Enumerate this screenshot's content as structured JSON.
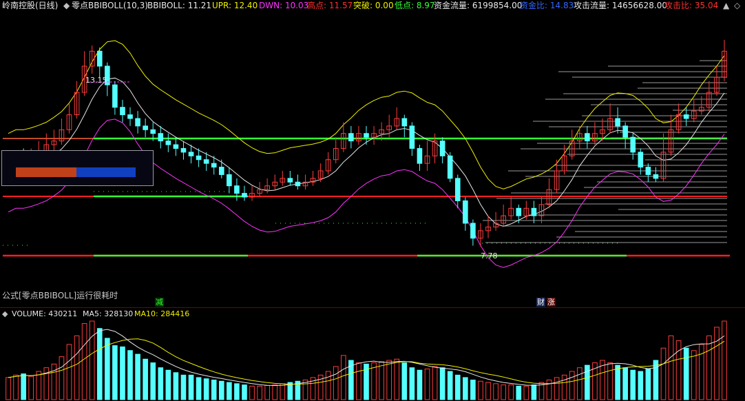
{
  "header": {
    "stock": "岭南控股(日线)",
    "indicator": "零点BBIBOLL(10,3)",
    "bbiboll": "BBIBOLL: 11.21",
    "upr": "UPR: 12.40",
    "dwn": "DWN: 10.03",
    "high": "高点: 11.57",
    "breakout": "突破: 0.00",
    "low": "低点: 8.97",
    "capital_flow": "资金流量: 6199854.00",
    "capital_ratio": "资金比: 14.83",
    "attack_flow": "攻击流量: 14656628.00",
    "attack_ratio": "攻击比: 35.04"
  },
  "colors": {
    "white": "#e8e8e8",
    "yellow": "#f0f000",
    "magenta": "#ff33ff",
    "red": "#ff3030",
    "green": "#33ff33",
    "blue": "#3366ff",
    "cyan": "#54ffff",
    "gray": "#c0c0c0"
  },
  "chart": {
    "high_label": "13.15",
    "low_label": "7.78"
  },
  "message": "公式[零点BBIBOLL]运行很耗时",
  "markers": {
    "reduce": "减",
    "finance": "财",
    "rise": "涨"
  },
  "volume": {
    "title": "VOLUME: 430211",
    "ma5": "MA5: 328130",
    "ma10": "MA10: 284416"
  },
  "chart_data": {
    "type": "candlestick",
    "price_range": [
      7.0,
      14.0
    ],
    "candles": [
      [
        9.8,
        9.8,
        10.2,
        9.5
      ],
      [
        9.8,
        10.0,
        10.3,
        9.6
      ],
      [
        10.0,
        9.9,
        10.4,
        9.7
      ],
      [
        9.9,
        10.1,
        10.4,
        9.7
      ],
      [
        10.1,
        10.3,
        10.6,
        10.0
      ],
      [
        10.3,
        10.5,
        10.8,
        10.1
      ],
      [
        10.5,
        10.6,
        10.9,
        10.3
      ],
      [
        10.6,
        10.9,
        11.2,
        10.5
      ],
      [
        10.9,
        11.3,
        11.6,
        10.8
      ],
      [
        11.3,
        11.9,
        12.2,
        11.2
      ],
      [
        11.9,
        12.6,
        13.0,
        11.8
      ],
      [
        12.6,
        13.0,
        13.15,
        12.4
      ],
      [
        13.0,
        12.6,
        13.1,
        12.3
      ],
      [
        12.6,
        12.1,
        12.7,
        11.8
      ],
      [
        12.1,
        11.5,
        12.2,
        11.3
      ],
      [
        11.5,
        11.3,
        11.7,
        11.1
      ],
      [
        11.3,
        11.2,
        11.5,
        11.0
      ],
      [
        11.2,
        11.0,
        11.4,
        10.8
      ],
      [
        11.0,
        10.9,
        11.2,
        10.7
      ],
      [
        10.9,
        10.8,
        11.1,
        10.6
      ],
      [
        10.8,
        10.6,
        11.0,
        10.4
      ],
      [
        10.6,
        10.5,
        10.8,
        10.3
      ],
      [
        10.5,
        10.4,
        10.7,
        10.2
      ],
      [
        10.4,
        10.3,
        10.6,
        10.1
      ],
      [
        10.3,
        10.2,
        10.5,
        10.0
      ],
      [
        10.2,
        10.1,
        10.4,
        9.9
      ],
      [
        10.1,
        10.0,
        10.3,
        9.8
      ],
      [
        10.0,
        9.9,
        10.2,
        9.7
      ],
      [
        9.9,
        9.7,
        10.1,
        9.6
      ],
      [
        9.7,
        9.4,
        9.9,
        9.2
      ],
      [
        9.4,
        9.2,
        9.6,
        9.0
      ],
      [
        9.2,
        9.1,
        9.4,
        9.0
      ],
      [
        9.1,
        9.2,
        9.4,
        9.0
      ],
      [
        9.2,
        9.3,
        9.5,
        9.1
      ],
      [
        9.3,
        9.4,
        9.6,
        9.2
      ],
      [
        9.4,
        9.5,
        9.7,
        9.3
      ],
      [
        9.5,
        9.6,
        9.8,
        9.4
      ],
      [
        9.6,
        9.5,
        9.8,
        9.4
      ],
      [
        9.5,
        9.4,
        9.7,
        9.3
      ],
      [
        9.4,
        9.5,
        9.7,
        9.3
      ],
      [
        9.5,
        9.6,
        9.8,
        9.4
      ],
      [
        9.6,
        9.8,
        10.0,
        9.5
      ],
      [
        9.8,
        10.1,
        10.3,
        9.7
      ],
      [
        10.1,
        10.4,
        10.7,
        10.0
      ],
      [
        10.4,
        10.8,
        11.1,
        10.3
      ],
      [
        10.8,
        10.6,
        11.0,
        10.4
      ],
      [
        10.6,
        10.8,
        11.0,
        10.5
      ],
      [
        10.8,
        10.7,
        11.0,
        10.5
      ],
      [
        10.7,
        10.8,
        11.0,
        10.5
      ],
      [
        10.8,
        10.9,
        11.1,
        10.6
      ],
      [
        10.9,
        11.0,
        11.3,
        10.7
      ],
      [
        11.0,
        11.2,
        11.5,
        10.9
      ],
      [
        11.2,
        11.0,
        11.3,
        10.7
      ],
      [
        11.0,
        10.4,
        11.1,
        10.2
      ],
      [
        10.4,
        10.0,
        10.5,
        9.8
      ],
      [
        10.0,
        10.2,
        10.6,
        9.8
      ],
      [
        10.2,
        10.6,
        10.8,
        10.0
      ],
      [
        10.6,
        10.2,
        10.7,
        10.0
      ],
      [
        10.2,
        9.6,
        10.3,
        9.5
      ],
      [
        9.6,
        9.0,
        9.7,
        8.8
      ],
      [
        9.0,
        8.4,
        9.1,
        8.2
      ],
      [
        8.4,
        8.0,
        8.5,
        7.8
      ],
      [
        8.0,
        8.2,
        8.4,
        7.78
      ],
      [
        8.2,
        8.3,
        8.6,
        8.0
      ],
      [
        8.3,
        8.4,
        8.7,
        8.2
      ],
      [
        8.4,
        8.6,
        8.9,
        8.3
      ],
      [
        8.6,
        8.8,
        9.1,
        8.5
      ],
      [
        8.8,
        8.6,
        8.9,
        8.4
      ],
      [
        8.6,
        8.8,
        9.0,
        8.5
      ],
      [
        8.8,
        8.6,
        9.0,
        8.4
      ],
      [
        8.6,
        8.9,
        9.1,
        8.4
      ],
      [
        8.9,
        9.3,
        9.6,
        8.8
      ],
      [
        9.3,
        9.8,
        10.1,
        9.2
      ],
      [
        9.8,
        10.2,
        10.5,
        9.7
      ],
      [
        10.2,
        10.6,
        10.9,
        10.1
      ],
      [
        10.6,
        10.8,
        11.0,
        10.4
      ],
      [
        10.8,
        10.6,
        11.0,
        10.4
      ],
      [
        10.6,
        10.8,
        11.1,
        10.5
      ],
      [
        10.8,
        10.9,
        11.2,
        10.6
      ],
      [
        10.9,
        11.2,
        11.6,
        10.8
      ],
      [
        11.2,
        11.0,
        11.5,
        10.8
      ],
      [
        11.0,
        10.7,
        11.1,
        10.4
      ],
      [
        10.7,
        10.3,
        10.8,
        10.1
      ],
      [
        10.3,
        9.9,
        10.4,
        9.7
      ],
      [
        9.9,
        9.7,
        10.0,
        9.5
      ],
      [
        9.7,
        9.6,
        9.9,
        9.5
      ],
      [
        9.6,
        10.3,
        10.8,
        9.5
      ],
      [
        10.3,
        10.9,
        11.3,
        10.2
      ],
      [
        10.9,
        11.3,
        11.6,
        10.8
      ],
      [
        11.3,
        11.2,
        11.5,
        11.0
      ],
      [
        11.2,
        11.4,
        11.7,
        11.1
      ],
      [
        11.4,
        11.5,
        11.8,
        11.3
      ],
      [
        11.5,
        11.9,
        12.2,
        11.4
      ],
      [
        11.9,
        12.3,
        12.6,
        11.8
      ],
      [
        12.3,
        13.0,
        13.3,
        12.2
      ]
    ],
    "volume": [
      180,
      200,
      210,
      190,
      230,
      260,
      290,
      350,
      450,
      520,
      620,
      640,
      580,
      500,
      440,
      430,
      400,
      370,
      330,
      300,
      260,
      240,
      220,
      200,
      200,
      180,
      170,
      160,
      150,
      140,
      130,
      120,
      110,
      110,
      115,
      120,
      130,
      140,
      150,
      160,
      180,
      200,
      230,
      270,
      360,
      320,
      300,
      290,
      300,
      310,
      320,
      330,
      300,
      260,
      240,
      250,
      270,
      260,
      230,
      200,
      180,
      160,
      150,
      140,
      130,
      120,
      120,
      110,
      110,
      120,
      140,
      160,
      180,
      200,
      230,
      260,
      280,
      300,
      320,
      300,
      280,
      260,
      240,
      230,
      250,
      320,
      420,
      520,
      480,
      420,
      400,
      450,
      520,
      590,
      640
    ]
  }
}
